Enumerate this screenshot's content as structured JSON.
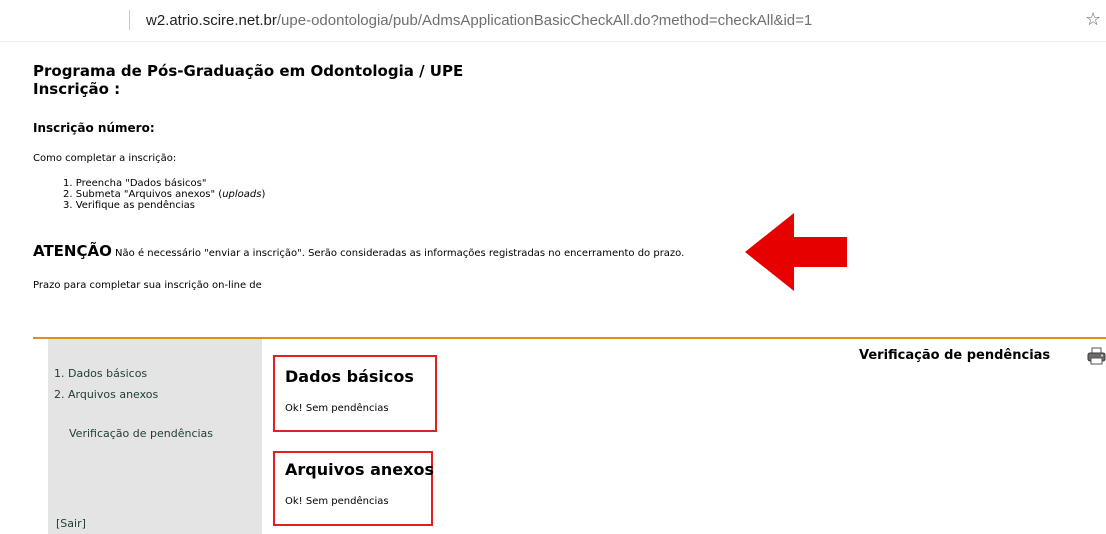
{
  "browser": {
    "url_host": "w2.atrio.scire.net.br",
    "url_path": "/upe-odontologia/pub/AdmsApplicationBasicCheckAll.do?method=checkAll&id=1",
    "star_icon": "☆"
  },
  "header": {
    "title": "Programa de Pós-Graduação em Odontologia / UPE",
    "subtitle": "Inscrição :"
  },
  "registration": {
    "number_label": "Inscrição número:"
  },
  "instructions": {
    "heading": "Como completar a inscrição:",
    "steps": [
      {
        "prefix": "1. Preencha \"Dados básicos\"",
        "italic": "",
        "suffix": ""
      },
      {
        "prefix": "2. Submeta \"Arquivos anexos\" (",
        "italic": "uploads",
        "suffix": ")"
      },
      {
        "prefix": "3. Verifique as pendências",
        "italic": "",
        "suffix": ""
      }
    ]
  },
  "attention": {
    "label": "ATENÇÃO",
    "text": "Não é necessário \"enviar a inscrição\". Serão consideradas as informações registradas no encerramento do prazo."
  },
  "deadline": {
    "text": "Prazo para completar sua inscrição on-line de"
  },
  "sidebar": {
    "items": [
      {
        "label": "1. Dados básicos"
      },
      {
        "label": "2. Arquivos anexos"
      },
      {
        "label": "Verificação de pendências"
      }
    ],
    "logout_label": "[Sair]"
  },
  "main": {
    "heading": "Verificação de pendências",
    "sections": [
      {
        "title": "Dados básicos",
        "status": "Ok! Sem pendências"
      },
      {
        "title": "Arquivos anexos",
        "status": "Ok! Sem pendências"
      }
    ]
  },
  "colors": {
    "accent_line": "#e48a1e",
    "highlight_box": "#e02020",
    "arrow": "#e60000",
    "sidebar_bg": "#e4e4e4"
  },
  "icons": {
    "arrow": "left-arrow-icon",
    "printer": "printer-icon"
  }
}
